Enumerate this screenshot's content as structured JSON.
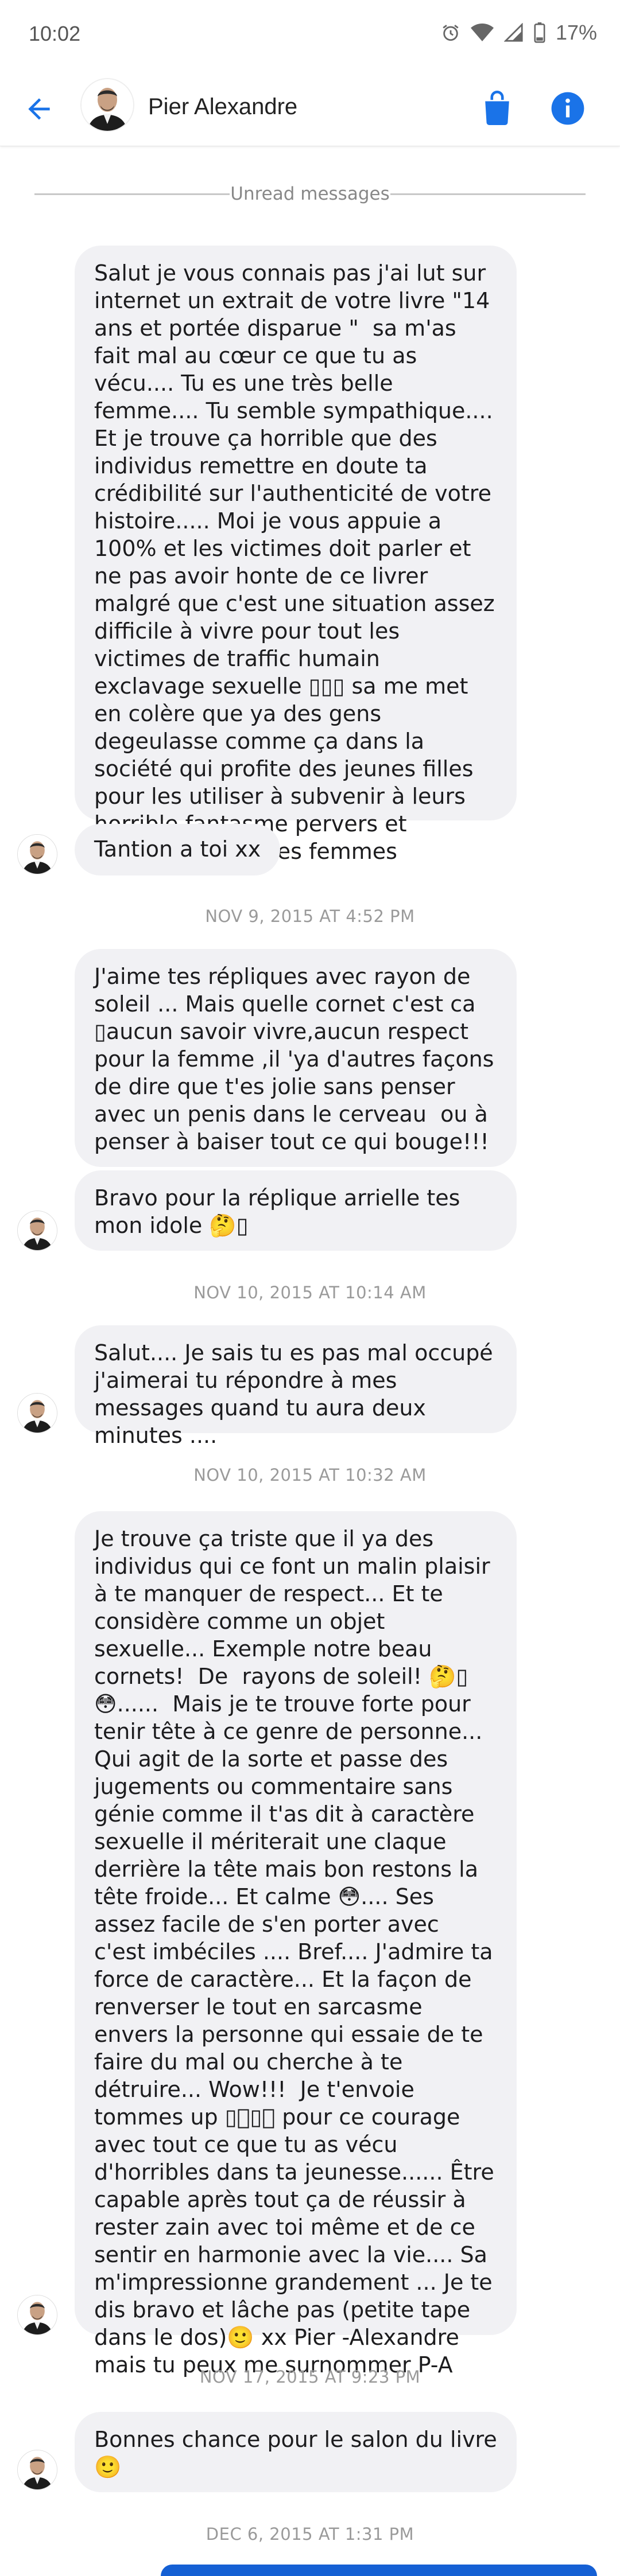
{
  "status_bar": {
    "time": "10:02",
    "battery": "17%"
  },
  "header": {
    "name": "Pier Alexandre"
  },
  "thread": {
    "unread_divider": "Unread messages",
    "messages": [
      "Salut je vous connais pas j'ai lut sur internet un extrait de votre livre \"14 ans et portée disparue \"  sa m'as fait mal au cœur ce que tu as vécu.... Tu es une très belle femme.... Tu semble sympathique.... Et je trouve ça horrible que des individus remettre en doute ta crédibilité sur l'authenticité de votre histoire..... Moi je vous appuie a 100% et les victimes doit parler et ne pas avoir honte de ce livrer malgré que c'est une situation assez difficile à vivre pour tout les victimes de traffic humain exclavage sexuelle ▯▯▯ sa me met en colère que ya des gens degeulasse comme ça dans la société qui profite des jeunes filles pour les utiliser à subvenir à leurs horrible fantasme pervers et degradant pour les femmes",
      "Tantion a toi xx",
      "J'aime tes répliques avec rayon de soleil ... Mais quelle cornet c'est ca ▯aucun savoir vivre,aucun respect pour la femme ,il 'ya d'autres façons de dire que t'es jolie sans penser avec un penis dans le cerveau  ou à penser à baiser tout ce qui bouge!!!",
      "Bravo pour la réplique arrielle tes mon idole 🤔▯",
      "Salut.... Je sais tu es pas mal occupé j'aimerai tu répondre à mes messages quand tu aura deux minutes ....",
      "Je trouve ça triste que il ya des individus qui ce font un malin plaisir à te manquer de respect... Et te considère comme un objet sexuelle... Exemple notre beau cornets!  De  rayons de soleil! 🤔▯😳......  Mais je te trouve forte pour tenir tête à ce genre de personne... Qui agit de la sorte et passe des jugements ou commentaire sans génie comme il t'as dit à caractère sexuelle il mériterait une claque derrière la tête mais bon restons la tête froide... Et calme 😳.... Ses assez facile de s'en porter avec c'est imbéciles .... Bref.... J'admire ta force de caractère... Et la façon de renverser le tout en sarcasme envers la personne qui essaie de te faire du mal ou cherche à te détruire... Wow!!!  Je t'envoie tommes up ▯🏻▯🏻 pour ce courage avec tout ce que tu as vécu d'horribles dans ta jeunesse...... Être  capable après tout ça de réussir à rester zain avec toi même et de ce sentir en harmonie avec la vie.... Sa m'impressionne grandement ... Je te dis bravo et lâche pas (petite tape dans le dos)🙂 xx Pier -Alexandre mais tu peux me surnommer P-A",
      "Bonnes chance pour le salon du livre 🙂"
    ],
    "timestamps": [
      "NOV 9, 2015 AT 4:52 PM",
      "NOV 10, 2015 AT 10:14 AM",
      "NOV 10, 2015 AT 10:32 AM",
      "NOV 17, 2015 AT 9:23 PM",
      "DEC 6, 2015 AT 1:31 PM"
    ]
  },
  "colors": {
    "accent": "#1a73e8",
    "bubble": "#f1f1f4",
    "divider": "#c8c8c8",
    "timestamp": "#9a9a9a"
  },
  "icons": [
    "alarm-icon",
    "wifi-icon",
    "signal-icon",
    "battery-icon",
    "back-arrow-icon",
    "bag-icon",
    "info-icon"
  ]
}
